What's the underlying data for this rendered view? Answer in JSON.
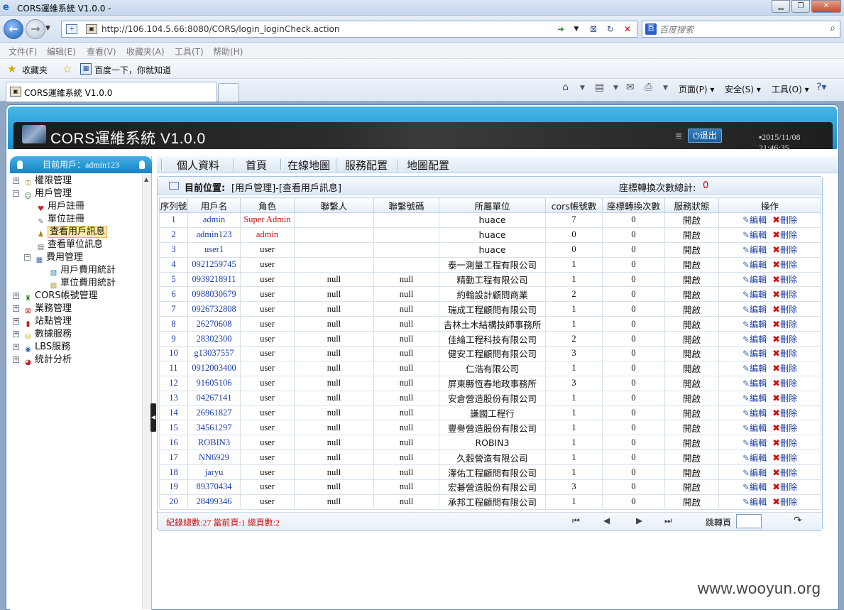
{
  "window": {
    "title": "CORS運維系統 V1.0.0 -"
  },
  "browser": {
    "url": "http://106.104.5.66:8080/CORS/login_loginCheck.action",
    "search_placeholder": "百度搜索",
    "menu": [
      "文件(F)",
      "编辑(E)",
      "查看(V)",
      "收藏夹(A)",
      "工具(T)",
      "帮助(H)"
    ],
    "favorites_label": "收藏夹",
    "favorite_link": "百度一下，你就知道",
    "tab_title": "CORS運維系統 V1.0.0",
    "commands": {
      "page": "页面(P)",
      "safety": "安全(S)",
      "tools": "工具(O)"
    }
  },
  "app": {
    "title": "CORS運維系統  V1.0.0",
    "logout_label": "退出",
    "datetime": "2015/11/08 21:46:35",
    "current_user_label": "目前用戶：admin123"
  },
  "sidebar": {
    "tree": [
      {
        "label": "權限管理",
        "icon": "permissions-icon"
      },
      {
        "label": "用戶管理",
        "icon": "users-icon"
      },
      {
        "label": "用戶註冊",
        "icon": "heart-icon"
      },
      {
        "label": "單位註冊",
        "icon": "document-icon"
      },
      {
        "label": "查看用戶訊息",
        "icon": "user-view-icon"
      },
      {
        "label": "查看單位訊息",
        "icon": "unit-view-icon"
      },
      {
        "label": "費用管理",
        "icon": "fee-icon"
      },
      {
        "label": "用戶費用統計",
        "icon": "user-fee-icon"
      },
      {
        "label": "單位費用統計",
        "icon": "unit-fee-icon"
      },
      {
        "label": "CORS帳號管理",
        "icon": "account-icon"
      },
      {
        "label": "業務管理",
        "icon": "business-icon"
      },
      {
        "label": "站點管理",
        "icon": "station-icon"
      },
      {
        "label": "數據服務",
        "icon": "database-icon"
      },
      {
        "label": "LBS服務",
        "icon": "globe-icon"
      },
      {
        "label": "統計分析",
        "icon": "chart-icon"
      }
    ]
  },
  "topnav": {
    "items": [
      "個人資料",
      "首頁",
      "在線地圖",
      "服務配置",
      "地圖配置"
    ]
  },
  "panel": {
    "location_label": "目前位置:",
    "location_value": "[用戶管理]-[查看用戶訊息]",
    "transform_total_label": "座標轉換次數總計:",
    "transform_total_value": "0",
    "columns": [
      "序列號",
      "用戶名",
      "角色",
      "聯繫人",
      "聯繫號碼",
      "所屬單位",
      "cors帳號數",
      "座標轉換次數",
      "服務狀態",
      "操作"
    ],
    "edit_label": "編輯",
    "delete_label": "刪除",
    "rows": [
      {
        "id": "1",
        "username": "admin",
        "role": "Super Admin",
        "contact": "",
        "phone": "",
        "unit": "huace",
        "cors": "7",
        "transforms": "0",
        "status": "開啟"
      },
      {
        "id": "2",
        "username": "admin123",
        "role": "admin",
        "contact": "",
        "phone": "",
        "unit": "huace",
        "cors": "0",
        "transforms": "0",
        "status": "開啟"
      },
      {
        "id": "3",
        "username": "user1",
        "role": "user",
        "contact": "",
        "phone": "",
        "unit": "huace",
        "cors": "0",
        "transforms": "0",
        "status": "開啟"
      },
      {
        "id": "4",
        "username": "0921259745",
        "role": "user",
        "contact": "",
        "phone": "",
        "unit": "泰一測量工程有限公司",
        "cors": "1",
        "transforms": "0",
        "status": "開啟"
      },
      {
        "id": "5",
        "username": "0939218911",
        "role": "user",
        "contact": "null",
        "phone": "null",
        "unit": "精勤工程有限公司",
        "cors": "1",
        "transforms": "0",
        "status": "開啟"
      },
      {
        "id": "6",
        "username": "0988030679",
        "role": "user",
        "contact": "null",
        "phone": "null",
        "unit": "約翰設計顧問商業",
        "cors": "2",
        "transforms": "0",
        "status": "開啟"
      },
      {
        "id": "7",
        "username": "0926732808",
        "role": "user",
        "contact": "null",
        "phone": "null",
        "unit": "瑞成工程顧問有限公司",
        "cors": "1",
        "transforms": "0",
        "status": "開啟"
      },
      {
        "id": "8",
        "username": "26270608",
        "role": "user",
        "contact": "null",
        "phone": "null",
        "unit": "吉林土木結構技師事務所",
        "cors": "1",
        "transforms": "0",
        "status": "開啟"
      },
      {
        "id": "9",
        "username": "28302300",
        "role": "user",
        "contact": "null",
        "phone": "null",
        "unit": "佳綸工程科技有限公司",
        "cors": "2",
        "transforms": "0",
        "status": "開啟"
      },
      {
        "id": "10",
        "username": "g13037557",
        "role": "user",
        "contact": "null",
        "phone": "null",
        "unit": "健安工程顧問有限公司",
        "cors": "3",
        "transforms": "0",
        "status": "開啟"
      },
      {
        "id": "11",
        "username": "0912003400",
        "role": "user",
        "contact": "null",
        "phone": "null",
        "unit": "仁浩有限公司",
        "cors": "1",
        "transforms": "0",
        "status": "開啟"
      },
      {
        "id": "12",
        "username": "91605106",
        "role": "user",
        "contact": "null",
        "phone": "null",
        "unit": "屏東縣恆春地政事務所",
        "cors": "3",
        "transforms": "0",
        "status": "開啟"
      },
      {
        "id": "13",
        "username": "04267141",
        "role": "user",
        "contact": "null",
        "phone": "null",
        "unit": "安倉營造股份有限公司",
        "cors": "1",
        "transforms": "0",
        "status": "開啟"
      },
      {
        "id": "14",
        "username": "26961827",
        "role": "user",
        "contact": "null",
        "phone": "null",
        "unit": "謙國工程行",
        "cors": "1",
        "transforms": "0",
        "status": "開啟"
      },
      {
        "id": "15",
        "username": "34561297",
        "role": "user",
        "contact": "null",
        "phone": "null",
        "unit": "豐譽營造股份有限公司",
        "cors": "1",
        "transforms": "0",
        "status": "開啟"
      },
      {
        "id": "16",
        "username": "ROBIN3",
        "role": "user",
        "contact": "null",
        "phone": "null",
        "unit": "ROBIN3",
        "cors": "1",
        "transforms": "0",
        "status": "開啟"
      },
      {
        "id": "17",
        "username": "NN6929",
        "role": "user",
        "contact": "null",
        "phone": "null",
        "unit": "久穀營造有限公司",
        "cors": "1",
        "transforms": "0",
        "status": "開啟"
      },
      {
        "id": "18",
        "username": "jaryu",
        "role": "user",
        "contact": "null",
        "phone": "null",
        "unit": "澤佑工程顧問有限公司",
        "cors": "1",
        "transforms": "0",
        "status": "開啟"
      },
      {
        "id": "19",
        "username": "89370434",
        "role": "user",
        "contact": "null",
        "phone": "null",
        "unit": "宏碁營造股份有限公司",
        "cors": "3",
        "transforms": "0",
        "status": "開啟"
      },
      {
        "id": "20",
        "username": "28499346",
        "role": "user",
        "contact": "null",
        "phone": "null",
        "unit": "承邦工程顧問有限公司",
        "cors": "1",
        "transforms": "0",
        "status": "開啟"
      }
    ],
    "footer": {
      "stats": "紀錄總數:27  當前頁:1  總頁數:2",
      "jump_label": "跳轉頁"
    }
  },
  "watermark": "www.wooyun.org"
}
